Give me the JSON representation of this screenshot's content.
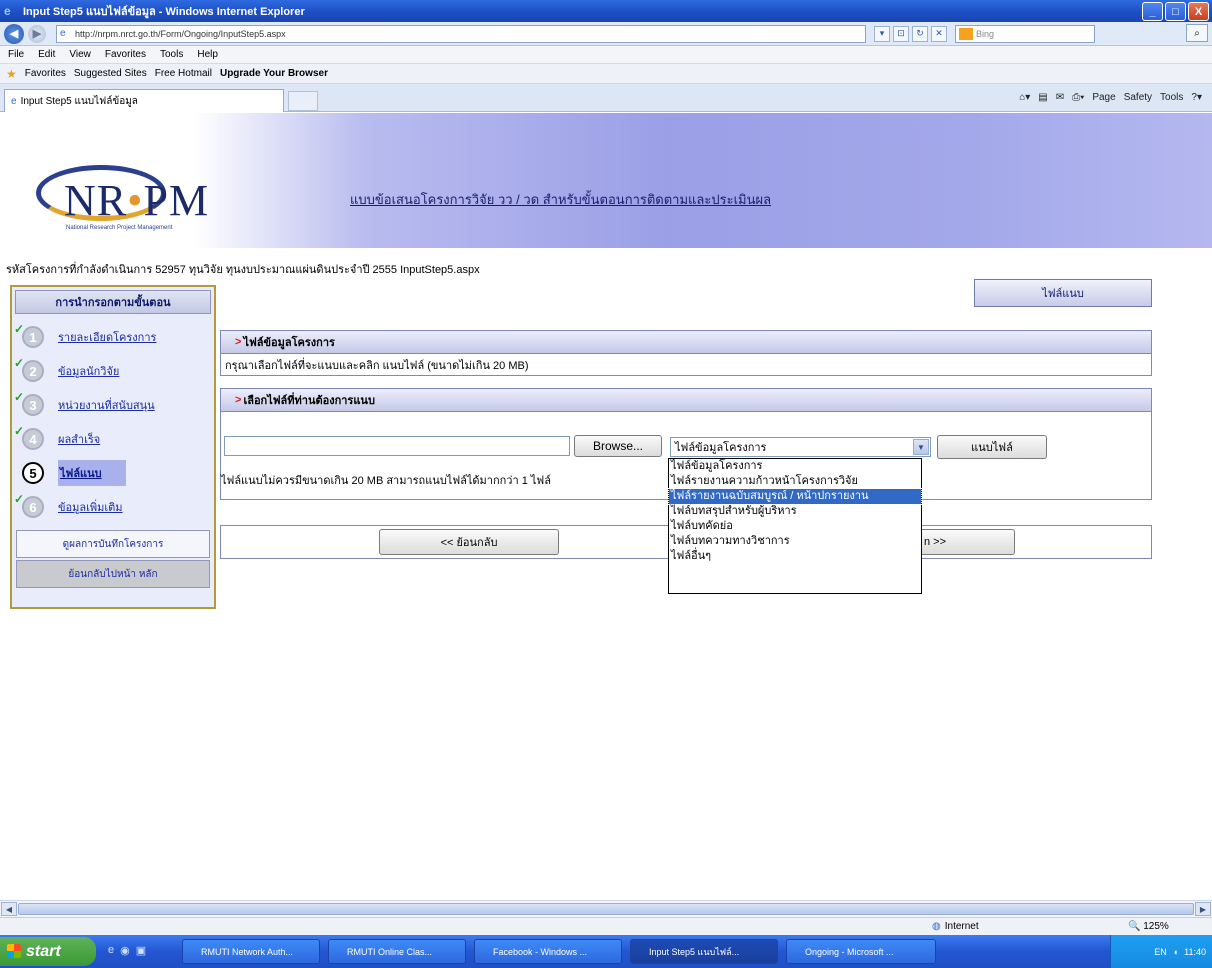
{
  "window": {
    "title": "Input Step5 แนบไฟล์ข้อมูล - Windows Internet Explorer",
    "minimize": "_",
    "maximize": "□",
    "close": "X"
  },
  "addressbar": {
    "url": "http://nrpm.nrct.go.th/Form/Ongoing/InputStep5.aspx",
    "search_placeholder": "Bing"
  },
  "menu": [
    "File",
    "Edit",
    "View",
    "Favorites",
    "Tools",
    "Help"
  ],
  "favorites": {
    "label": "Favorites",
    "items": [
      "Suggested Sites",
      "Free Hotmail",
      "Upgrade Your Browser"
    ]
  },
  "tab": {
    "label": "Input Step5 แนบไฟล์ข้อมูล"
  },
  "commandbar": [
    "Page",
    "Safety",
    "Tools"
  ],
  "banner": {
    "logo_text": "NRPM",
    "logo_sub": "National Research Project Management",
    "title": "แบบข้อเสนอโครงการวิจัย วว / วด สำหรับขั้นตอนการติดตามและประเมินผล"
  },
  "info_line": "รหัสโครงการที่กำลังดำเนินการ 52957 ทุนวิจัย ทุนงบประมาณแผ่นดินประจำปี 2555 InputStep5.aspx",
  "sidebar": {
    "header": "การนำกรอกตามขั้นตอน",
    "steps": [
      {
        "number": "1",
        "label": "รายละเอียดโครงการ",
        "done": true
      },
      {
        "number": "2",
        "label": "ข้อมูลนักวิจัย",
        "done": true
      },
      {
        "number": "3",
        "label": "หน่วยงานที่สนับสนุน",
        "done": true
      },
      {
        "number": "4",
        "label": "ผลสำเร็จ",
        "done": true
      },
      {
        "number": "5",
        "label": "ไฟล์แนบ",
        "done": false
      },
      {
        "number": "6",
        "label": "ข้อมูลเพิ่มเติม",
        "done": true
      }
    ],
    "save_button": "ดูผลการบันทึกโครงการ",
    "home_button": "ย้อนกลับไปหน้า หลัก"
  },
  "attach_top_button": "ไฟล์แนบ",
  "section1": {
    "header": "ไฟล์ข้อมูลโครงการ",
    "body": "กรุณาเลือกไฟล์ที่จะแนบและคลิก แนบไฟล์ (ขนาดไม่เกิน 20 MB)"
  },
  "section2": {
    "header": "เลือกไฟล์ที่ท่านต้องการแนบ"
  },
  "upload": {
    "browse": "Browse...",
    "selected_type": "ไฟล์ข้อมูลโครงการ",
    "attach_button": "แนบไฟล์",
    "note": "ไฟล์แนบไม่ควรมีขนาดเกิน 20 MB สามารถแนบไฟล์ได้มากกว่า 1 ไฟล์"
  },
  "dropdown_options": [
    "ไฟล์ข้อมูลโครงการ",
    "ไฟล์รายงานความก้าวหน้าโครงการวิจัย",
    "ไฟล์รายงานฉบับสมบูรณ์ / หน้าปกรายงาน",
    "ไฟล์บทสรุปสำหรับผู้บริหาร",
    "ไฟล์บทคัดย่อ",
    "ไฟล์บทความทางวิชาการ",
    "ไฟล์อื่นๆ"
  ],
  "dropdown_selected_index": 2,
  "nav": {
    "back": "<< ย้อนกลับ",
    "next": "n >>"
  },
  "status": {
    "zone": "Internet",
    "zoom": "125%"
  },
  "taskbar": {
    "start": "start",
    "items": [
      "RMUTI Network Auth...",
      "RMUTI Online Clas...",
      "Facebook - Windows ...",
      "Input Step5 แนบไฟล์...",
      "Ongoing - Microsoft ..."
    ],
    "lang": "EN",
    "clock": "11:40"
  }
}
